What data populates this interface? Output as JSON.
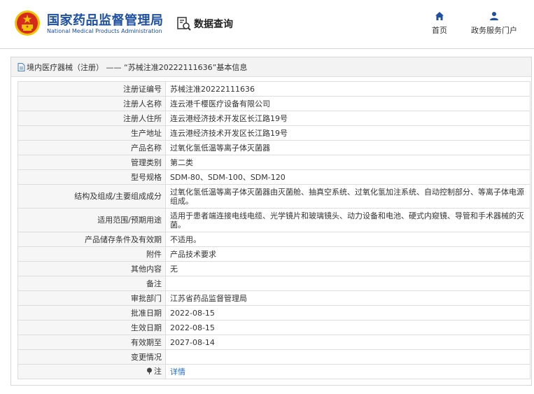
{
  "header": {
    "brand_cn": "国家药品监督管理局",
    "brand_en": "National Medical Products Administration",
    "query_label": "数据查询",
    "nav": [
      {
        "label": "首页",
        "icon": "home-icon"
      },
      {
        "label": "政务服务门户",
        "icon": "user-icon"
      }
    ]
  },
  "panel": {
    "title": "境内医疗器械（注册） —— “苏械注准20222111636”基本信息"
  },
  "rows": [
    {
      "label": "注册证编号",
      "value": "苏械注准20222111636"
    },
    {
      "label": "注册人名称",
      "value": "连云港千樱医疗设备有限公司"
    },
    {
      "label": "注册人住所",
      "value": "连云港经济技术开发区长江路19号"
    },
    {
      "label": "生产地址",
      "value": "连云港经济技术开发区长江路19号"
    },
    {
      "label": "产品名称",
      "value": "过氧化氢低温等离子体灭菌器"
    },
    {
      "label": "管理类别",
      "value": "第二类"
    },
    {
      "label": "型号规格",
      "value": "SDM-80、SDM-100、SDM-120"
    },
    {
      "label": "结构及组成/主要组成成分",
      "value": "过氧化氢低温等离子体灭菌器由灭菌舱、抽真空系统、过氧化氢加注系统、自动控制部分、等离子体电源组成。"
    },
    {
      "label": "适用范围/预期用途",
      "value": "适用于患者端连接电线电缆、光学镜片和玻璃镜头、动力设备和电池、硬式内窥镜、导管和手术器械的灭菌。"
    },
    {
      "label": "产品储存条件及有效期",
      "value": "不适用。"
    },
    {
      "label": "附件",
      "value": "产品技术要求"
    },
    {
      "label": "其他内容",
      "value": "无"
    },
    {
      "label": "备注",
      "value": ""
    },
    {
      "label": "审批部门",
      "value": "江苏省药品监督管理局"
    },
    {
      "label": "批准日期",
      "value": "2022-08-15"
    },
    {
      "label": "生效日期",
      "value": "2022-08-15"
    },
    {
      "label": "有效期至",
      "value": "2027-08-14"
    },
    {
      "label": "变更情况",
      "value": ""
    }
  ],
  "note_row": {
    "label": "注",
    "link": "详情"
  },
  "colors": {
    "brand": "#1e4fa0",
    "emblem_red": "#d52b1e",
    "emblem_gold": "#f2c300",
    "link": "#2b6cc4"
  }
}
